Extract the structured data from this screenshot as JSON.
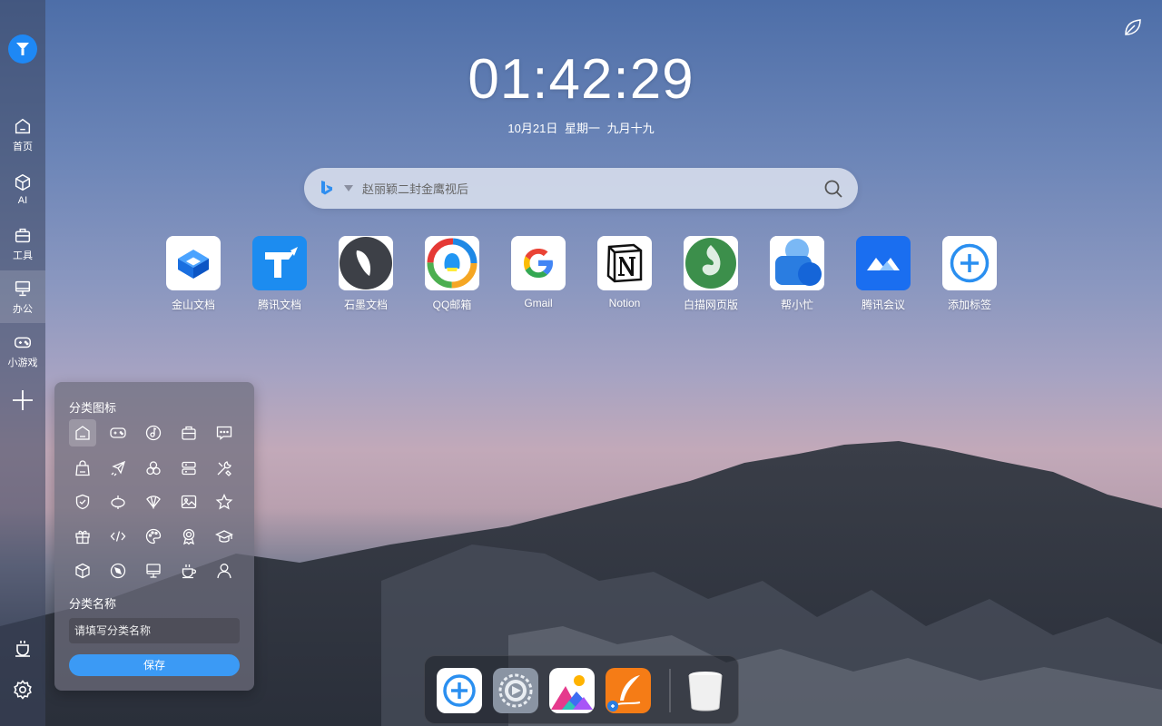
{
  "clock": {
    "time": "01:42:29",
    "date": "10月21日  星期一  九月十九"
  },
  "search": {
    "placeholder": "赵丽颖二封金鹰视后",
    "engine_icon": "bing-icon"
  },
  "sidebar": {
    "items": [
      {
        "label": "首页",
        "icon": "home-icon"
      },
      {
        "label": "AI",
        "icon": "cube-icon"
      },
      {
        "label": "工具",
        "icon": "toolbox-icon"
      },
      {
        "label": "办公",
        "icon": "monitor-icon"
      },
      {
        "label": "小游戏",
        "icon": "gamepad-icon"
      }
    ],
    "active": "办公"
  },
  "apps": [
    {
      "label": "金山文档",
      "icon": "kingsoft-docs-icon"
    },
    {
      "label": "腾讯文档",
      "icon": "tencent-docs-icon"
    },
    {
      "label": "石墨文档",
      "icon": "shimo-docs-icon"
    },
    {
      "label": "QQ邮箱",
      "icon": "qq-mail-icon"
    },
    {
      "label": "Gmail",
      "icon": "google-icon"
    },
    {
      "label": "Notion",
      "icon": "notion-icon"
    },
    {
      "label": "白描网页版",
      "icon": "baimiao-icon"
    },
    {
      "label": "帮小忙",
      "icon": "bangxiaomang-icon"
    },
    {
      "label": "腾讯会议",
      "icon": "tencent-meeting-icon"
    },
    {
      "label": "添加标签",
      "icon": "add-circle-icon"
    }
  ],
  "panel": {
    "icon_title": "分类图标",
    "name_title": "分类名称",
    "name_placeholder": "请填写分类名称",
    "save_label": "保存",
    "icons": [
      "home-icon",
      "gamepad-icon",
      "music-disc-icon",
      "toolbox-icon",
      "message-icon",
      "shopping-bag-icon",
      "plane-icon",
      "clover-icon",
      "server-icon",
      "tools-icon",
      "shield-icon",
      "lantern-icon",
      "fan-icon",
      "image-icon",
      "star-icon",
      "gift-icon",
      "code-icon",
      "palette-icon",
      "award-icon",
      "graduation-cap-icon",
      "box-icon",
      "compass-icon",
      "monitor-icon",
      "coffee-icon",
      "user-icon"
    ]
  },
  "dock": [
    {
      "icon": "add-circle-icon"
    },
    {
      "icon": "settings-app-icon"
    },
    {
      "icon": "gallery-icon"
    },
    {
      "icon": "quill-app-icon"
    },
    {
      "icon": "trash-icon"
    }
  ],
  "colors": {
    "accent": "#3b9af5",
    "logo": "#1e88f5"
  }
}
